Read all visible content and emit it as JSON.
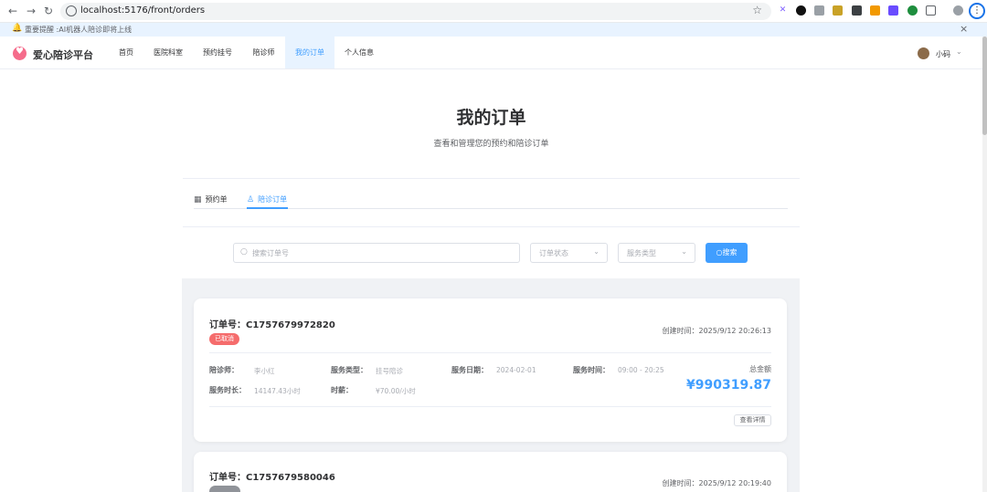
{
  "browser": {
    "url": "localhost:5176/front/orders",
    "back_icon": "arrow-left-icon",
    "forward_icon": "arrow-right-icon",
    "reload_icon": "reload-icon",
    "menu_icon": "kebab-menu-icon"
  },
  "notice": {
    "text": "重要提醒 :AI机器人陪诊即将上线",
    "icon": "bell-icon"
  },
  "header": {
    "logo_text": "爱心陪诊平台",
    "nav": [
      "首页",
      "医院科室",
      "预约挂号",
      "陪诊师",
      "我的订单",
      "个人信息"
    ],
    "active_nav": "我的订单",
    "user_name": "小码"
  },
  "page": {
    "title": "我的订单",
    "subtitle": "查看和管理您的预约和陪诊订单"
  },
  "tabs": [
    {
      "label": "预约单",
      "icon": "calendar-icon"
    },
    {
      "label": "陪诊订单",
      "icon": "user-icon"
    }
  ],
  "filters": {
    "search_placeholder": "搜索订单号",
    "status_placeholder": "订单状态",
    "type_placeholder": "服务类型",
    "search_button": "搜索"
  },
  "orders": [
    {
      "order_no_label": "订单号：",
      "order_no": "C1757679972820",
      "status": "已取消",
      "status_color": "#f56c6c",
      "created": "创建时间：2025/9/12 20:26:13",
      "companion_label": "陪诊师：",
      "companion": "李小红",
      "service_type_label": "服务类型：",
      "service_type": "挂号陪诊",
      "service_date_label": "服务日期：",
      "service_date": "2024-02-01",
      "service_time_label": "服务时间：",
      "service_time": "09:00 - 20:25",
      "duration_label": "服务时长：",
      "duration": "14147.43小时",
      "rate_label": "时薪：",
      "rate": "¥70.00/小时",
      "total_label": "总金额",
      "total": "¥990319.87",
      "detail_button": "查看详情"
    },
    {
      "order_no_label": "订单号：",
      "order_no": "C1757679580046",
      "status": "",
      "status_color": "#909399",
      "created": "创建时间：2025/9/12 20:19:40"
    }
  ],
  "colors": {
    "accent": "#409eff",
    "cancel": "#f56c6c",
    "nav_active_bg": "#e8f3ff"
  }
}
